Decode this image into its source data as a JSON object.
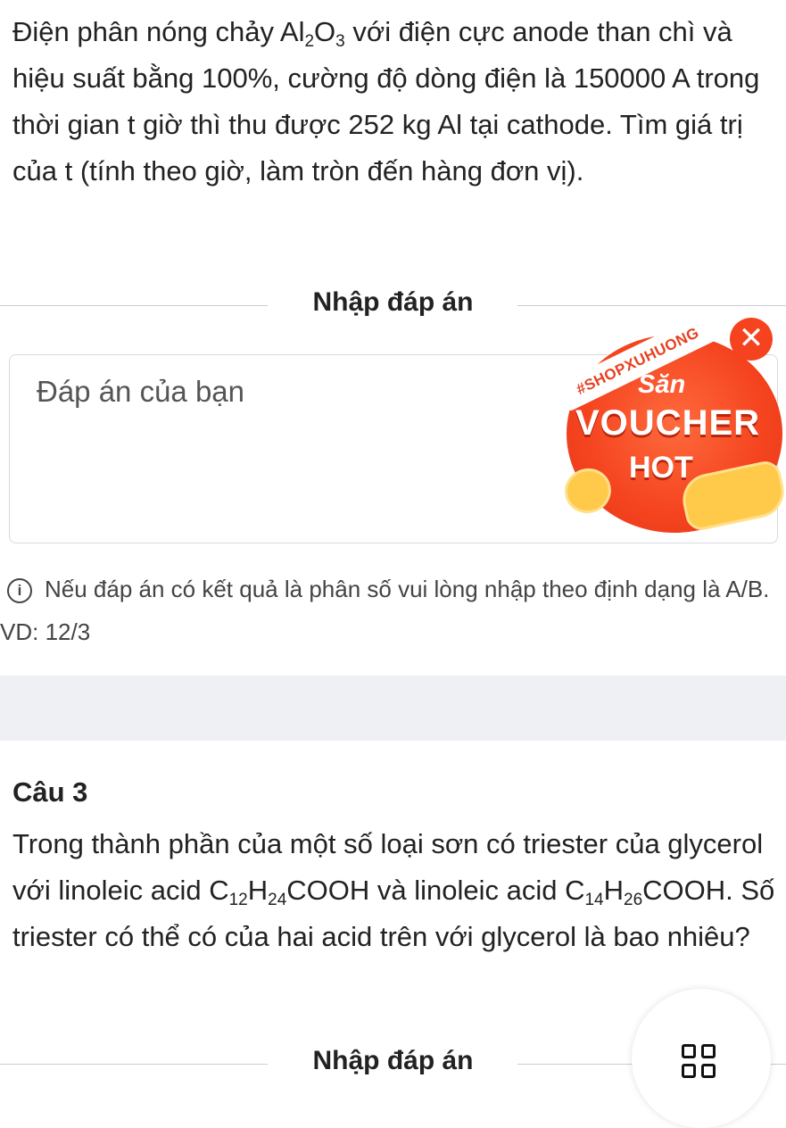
{
  "question2": {
    "text_parts": [
      "Điện phân nóng chảy Al",
      "2",
      "O",
      "3",
      " với điện cực anode than chì và hiệu suất bằng 100%, cường độ dòng điện là 150000 A trong thời gian t giờ thì thu được 252 kg Al tại cathode. Tìm giá trị của t (tính theo giờ, làm tròn đến hàng đơn vị)."
    ]
  },
  "answer_section": {
    "divider_label": "Nhập đáp án",
    "input_placeholder": "Đáp án của bạn",
    "hint": "Nếu đáp án có kết quả là phân số vui lòng nhập theo định dạng là A/B. VD: 12/3"
  },
  "voucher_popup": {
    "tag": "#SHOPXUHUONG",
    "line1": "Săn",
    "line2": "VOUCHER",
    "line3": "HOT",
    "close_icon": "close-icon"
  },
  "question3": {
    "title": "Câu 3",
    "text_parts": [
      "Trong thành phần của một số loại sơn có triester của glycerol với linoleic acid C",
      "12",
      "H",
      "24",
      "COOH và linoleic acid C",
      "14",
      "H",
      "26",
      "COOH. Số triester có thể có của hai acid trên với glycerol là bao nhiêu?"
    ],
    "divider_label": "Nhập đáp án"
  },
  "floating_button": {
    "icon": "grid-menu-icon"
  }
}
